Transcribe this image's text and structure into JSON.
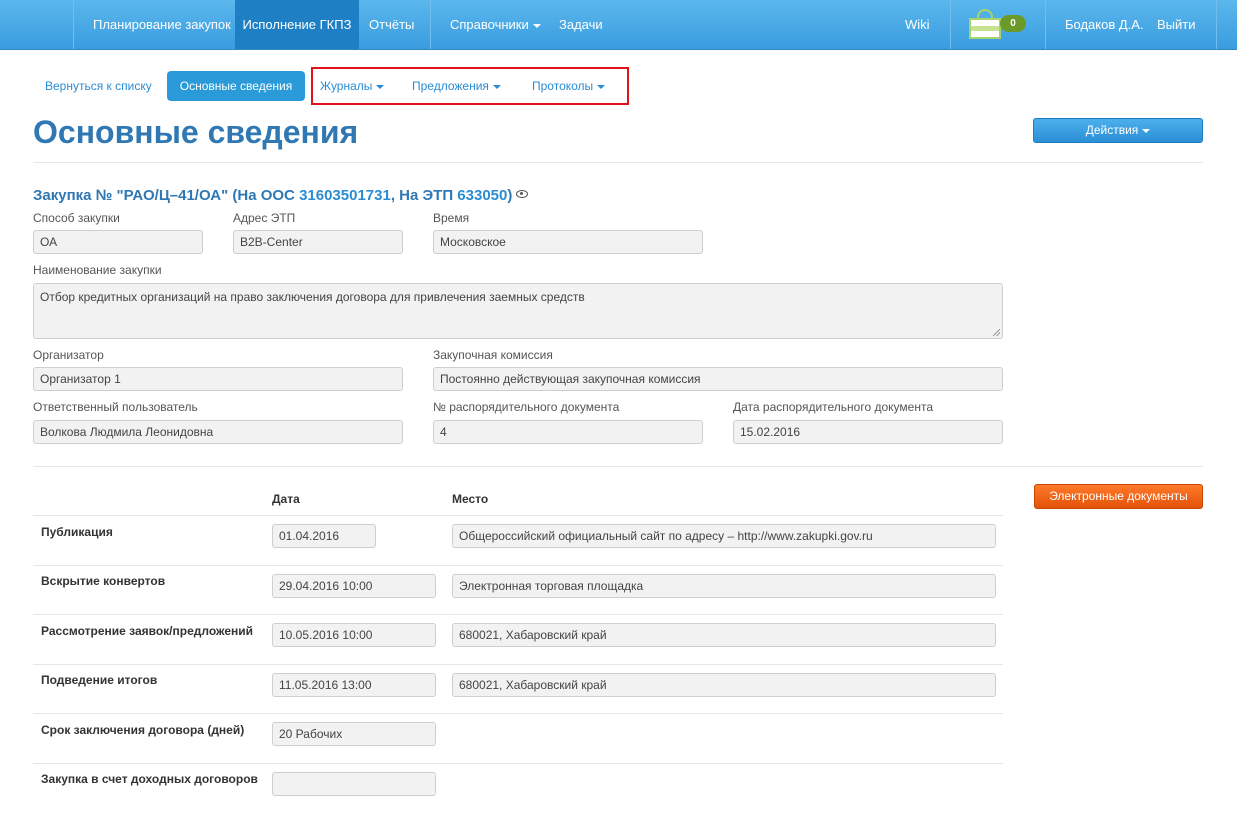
{
  "navbar": {
    "items": [
      {
        "label": "Планирование закупок",
        "active": false
      },
      {
        "label": "Исполнение ГКПЗ",
        "active": true
      },
      {
        "label": "Отчёты",
        "active": false
      },
      {
        "label": "Справочники",
        "active": false
      },
      {
        "label": "Задачи",
        "active": false
      }
    ],
    "wiki": "Wiki",
    "cart_count": "0",
    "user": "Бодаков Д.А.",
    "logout": "Выйти"
  },
  "subnav": {
    "back": "Вернуться к списку",
    "active_tab": "Основные сведения",
    "journals": "Журналы",
    "offers": "Предложения",
    "protocols": "Протоколы"
  },
  "page": {
    "title": "Основные сведения",
    "actions_button": "Действия",
    "edocs_button": "Электронные документы"
  },
  "purchase": {
    "prefix": "Закупка № \"РАО/Ц–41/ОА\" (На ООС ",
    "oos_number": "31603501731",
    "mid": ", На ЭТП ",
    "etp_number": "633050",
    "suffix": ")"
  },
  "form": {
    "method_label": "Способ закупки",
    "method_value": "ОА",
    "etp_label": "Адрес ЭТП",
    "etp_value": "B2B-Center",
    "time_label": "Время",
    "time_value": "Московское",
    "name_label": "Наименование закупки",
    "name_value": "Отбор кредитных организаций на право заключения договора для привлечения заемных средств",
    "org_label": "Организатор",
    "org_value": "Организатор 1",
    "commission_label": "Закупочная комиссия",
    "commission_value": "Постоянно действующая закупочная комиссия",
    "responsible_label": "Ответственный пользователь",
    "responsible_value": "Волкова Людмила Леонидовна",
    "doc_num_label": "№ распорядительного документа",
    "doc_num_value": "4",
    "doc_date_label": "Дата распорядительного документа",
    "doc_date_value": "15.02.2016"
  },
  "schedule": {
    "col_date": "Дата",
    "col_place": "Место",
    "rows": [
      {
        "label": "Публикация",
        "date": "01.04.2016",
        "place": "Общероссийский официальный сайт по адресу – http://www.zakupki.gov.ru"
      },
      {
        "label": "Вскрытие конвертов",
        "date": "29.04.2016 10:00",
        "place": "Электронная торговая площадка"
      },
      {
        "label": "Рассмотрение заявок/предложений",
        "date": "10.05.2016 10:00",
        "place": "680021, Хабаровский край"
      },
      {
        "label": "Подведение итогов",
        "date": "11.05.2016 13:00",
        "place": "680021, Хабаровский край"
      },
      {
        "label": "Срок заключения договора (дней)",
        "date": "20 Рабочих",
        "place": ""
      },
      {
        "label": "Закупка в счет доходных договоров",
        "date": "",
        "place": ""
      }
    ]
  }
}
